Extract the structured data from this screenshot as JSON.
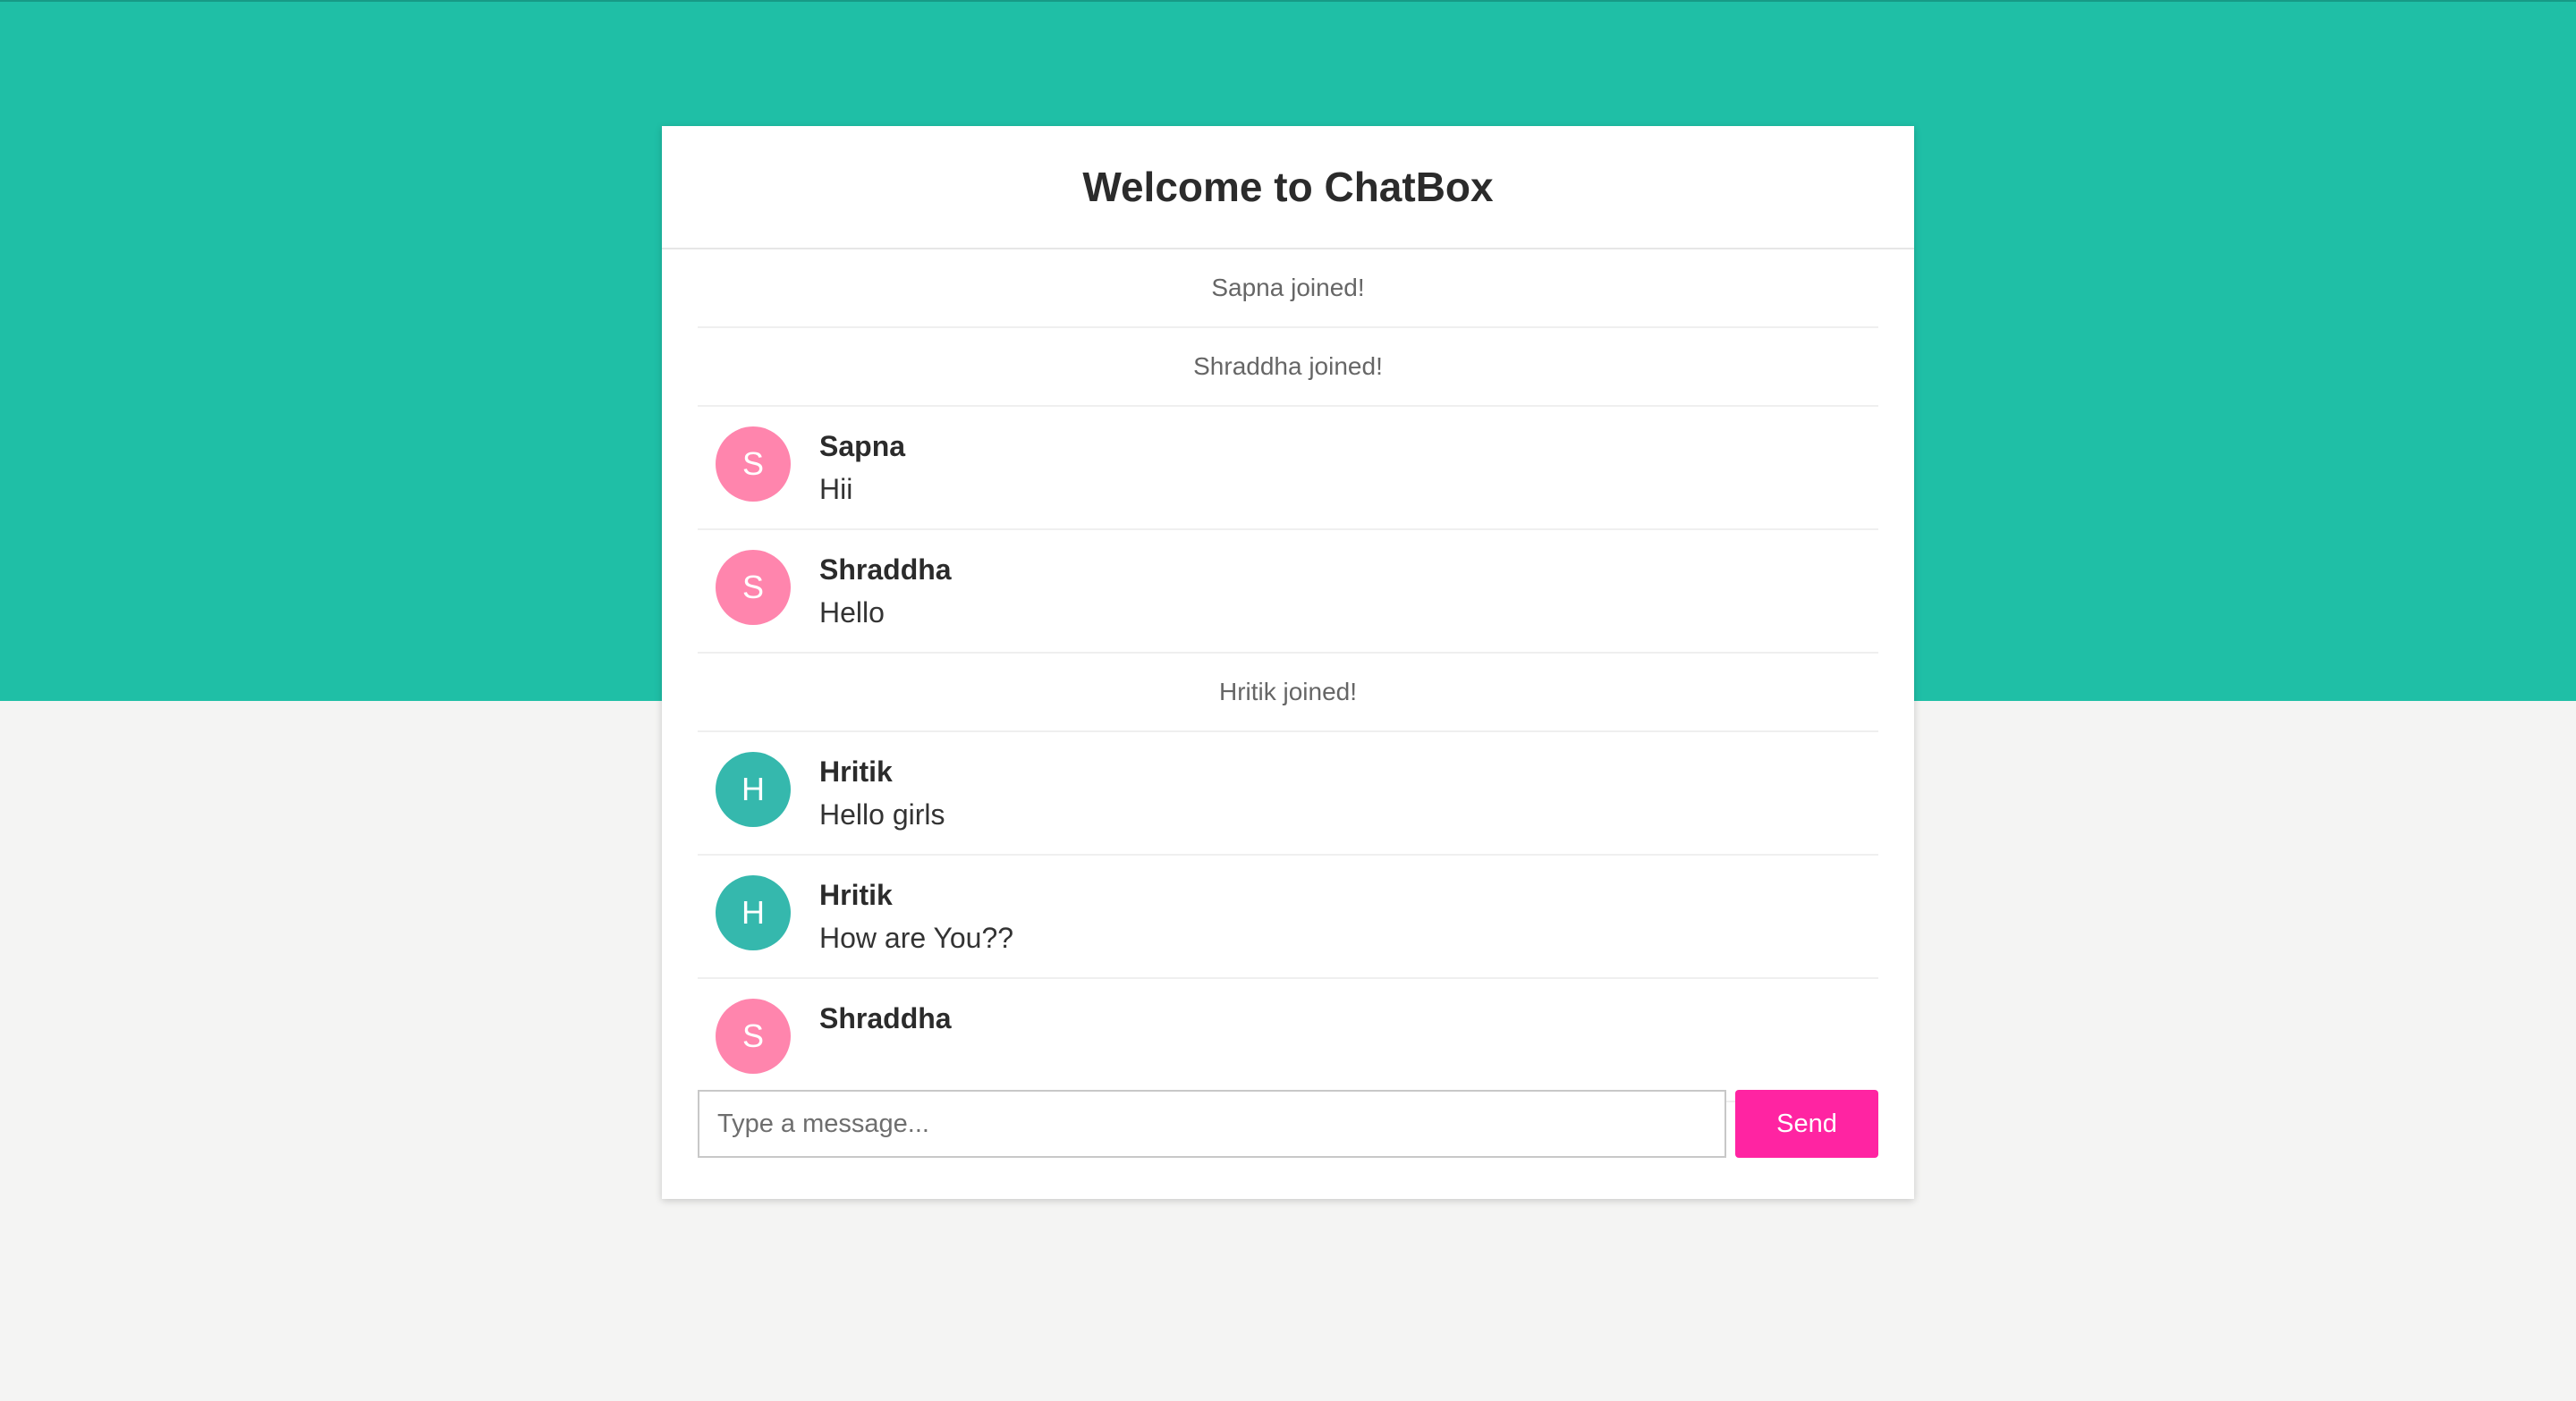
{
  "colors": {
    "top_band": "#1fbfa6",
    "page_background": "#f4f4f3",
    "avatar_pink": "#ff85ad",
    "avatar_teal": "#35b8ad",
    "send_button": "#ff24a2"
  },
  "header": {
    "title": "Welcome to ChatBox"
  },
  "messages": [
    {
      "type": "event",
      "text": "Sapna joined!"
    },
    {
      "type": "event",
      "text": "Shraddha joined!"
    },
    {
      "type": "chat",
      "initial": "S",
      "avatar_color": "#ff85ad",
      "sender": "Sapna",
      "text": "Hii"
    },
    {
      "type": "chat",
      "initial": "S",
      "avatar_color": "#ff85ad",
      "sender": "Shraddha",
      "text": "Hello"
    },
    {
      "type": "event",
      "text": "Hritik joined!"
    },
    {
      "type": "chat",
      "initial": "H",
      "avatar_color": "#35b8ad",
      "sender": "Hritik",
      "text": "Hello girls"
    },
    {
      "type": "chat",
      "initial": "H",
      "avatar_color": "#35b8ad",
      "sender": "Hritik",
      "text": "How are You??"
    },
    {
      "type": "chat",
      "initial": "S",
      "avatar_color": "#ff85ad",
      "sender": "Shraddha",
      "text": ""
    }
  ],
  "input": {
    "placeholder": "Type a message...",
    "value": ""
  },
  "send_button": {
    "label": "Send"
  }
}
